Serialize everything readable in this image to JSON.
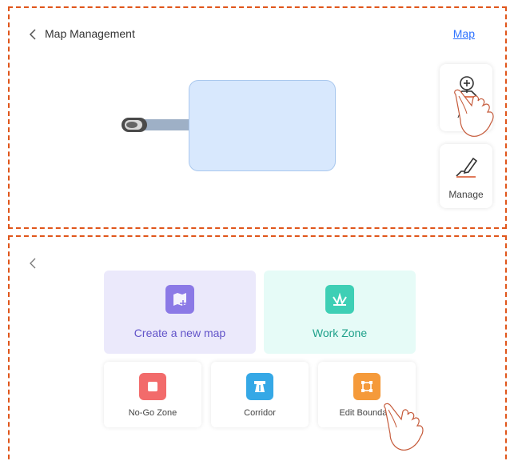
{
  "top_panel": {
    "title": "Map Management",
    "map_link": "Map",
    "add_label": "Add",
    "manage_label": "Manage"
  },
  "bottom_panel": {
    "cards": {
      "create_map": "Create a new map",
      "work_zone": "Work Zone",
      "no_go_zone": "No-Go Zone",
      "corridor": "Corridor",
      "edit_boundary": "Edit Boundary"
    }
  },
  "colors": {
    "dashed_border": "#e0561b",
    "link": "#2f73ff",
    "create_icon": "#8b79e6",
    "work_icon": "#3ecfb5",
    "no_go_icon": "#f26b6b",
    "corridor_icon": "#35a8e6",
    "edit_icon": "#f59a3a"
  },
  "icons": [
    "back-chevron-icon",
    "mower-icon",
    "add-location-icon",
    "edit-pen-icon",
    "map-plus-icon",
    "grass-icon",
    "square-icon",
    "road-icon",
    "crop-icon",
    "pointer-hand-icon"
  ]
}
